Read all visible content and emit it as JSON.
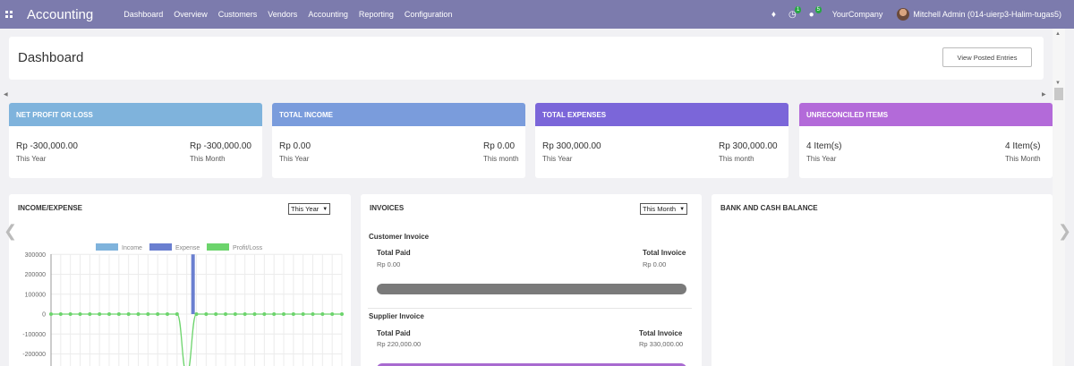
{
  "navbar": {
    "app_name": "Accounting",
    "menu": [
      "Dashboard",
      "Overview",
      "Customers",
      "Vendors",
      "Accounting",
      "Reporting",
      "Configuration"
    ],
    "activity_count": "1",
    "message_count": "5",
    "company": "YourCompany",
    "user": "Mitchell Admin (014-uierp3-Halim-tugas5)",
    "color": "#7c7bad"
  },
  "control": {
    "title": "Dashboard",
    "view_button": "View Posted Entries"
  },
  "cards": [
    {
      "title": "NET PROFIT OR LOSS",
      "year_amount": "Rp -300,000.00",
      "year_label": "This Year",
      "month_amount": "Rp -300,000.00",
      "month_label": "This Month",
      "color": "#7fb3dc"
    },
    {
      "title": "TOTAL INCOME",
      "year_amount": "Rp 0.00",
      "year_label": "This Year",
      "month_amount": "Rp 0.00",
      "month_label": "This month",
      "color": "#7a9cdc"
    },
    {
      "title": "TOTAL EXPENSES",
      "year_amount": "Rp 300,000.00",
      "year_label": "This Year",
      "month_amount": "Rp 300,000.00",
      "month_label": "This month",
      "color": "#7b66d9"
    },
    {
      "title": "UNRECONCILED ITEMS",
      "year_amount": "4 Item(s)",
      "year_label": "This Year",
      "month_amount": "4 Item(s)",
      "month_label": "This Month",
      "color": "#b36ad9"
    }
  ],
  "income_expense": {
    "title": "INCOME/EXPENSE",
    "period": "This Year"
  },
  "invoices": {
    "title": "INVOICES",
    "period": "This Month",
    "customer": {
      "heading": "Customer Invoice",
      "paid_label": "Total Paid",
      "paid_value": "Rp 0.00",
      "invoice_label": "Total Invoice",
      "invoice_value": "Rp 0.00",
      "bar_color": "#7a7a7a"
    },
    "supplier": {
      "heading": "Supplier Invoice",
      "paid_label": "Total Paid",
      "paid_value": "Rp 220,000.00",
      "invoice_label": "Total Invoice",
      "invoice_value": "Rp 330,000.00",
      "bar_color": "#a86ad0"
    }
  },
  "bank": {
    "title": "BANK AND CASH BALANCE"
  },
  "chart_data": {
    "type": "bar",
    "legend": [
      "Income",
      "Expense",
      "Profit/Loss"
    ],
    "legend_placement": "top",
    "colors": {
      "Income": "#7fb3dc",
      "Expense": "#6a7fd0",
      "Profit/Loss": "#6cd46c"
    },
    "y_ticks": [
      "300000",
      "200000",
      "100000",
      "0",
      "-100000",
      "-200000"
    ],
    "ylim": [
      -250000,
      320000
    ],
    "grid": true,
    "n_points": 31,
    "series": [
      {
        "name": "Income",
        "values": [
          0,
          0,
          0,
          0,
          0,
          0,
          0,
          0,
          0,
          0,
          0,
          0,
          0,
          0,
          0,
          0,
          0,
          0,
          0,
          0,
          0,
          0,
          0,
          0,
          0,
          0,
          0,
          0,
          0,
          0,
          0
        ]
      },
      {
        "name": "Expense",
        "values": [
          0,
          0,
          0,
          0,
          0,
          0,
          0,
          0,
          0,
          0,
          0,
          0,
          0,
          0,
          300000,
          0,
          0,
          0,
          0,
          0,
          0,
          0,
          0,
          0,
          0,
          0,
          0,
          0,
          0,
          0,
          0
        ]
      },
      {
        "name": "Profit/Loss",
        "values": [
          0,
          0,
          0,
          0,
          0,
          0,
          0,
          0,
          0,
          0,
          0,
          0,
          0,
          0,
          -300000,
          0,
          0,
          0,
          0,
          0,
          0,
          0,
          0,
          0,
          0,
          0,
          0,
          0,
          0,
          0,
          0
        ]
      }
    ]
  }
}
